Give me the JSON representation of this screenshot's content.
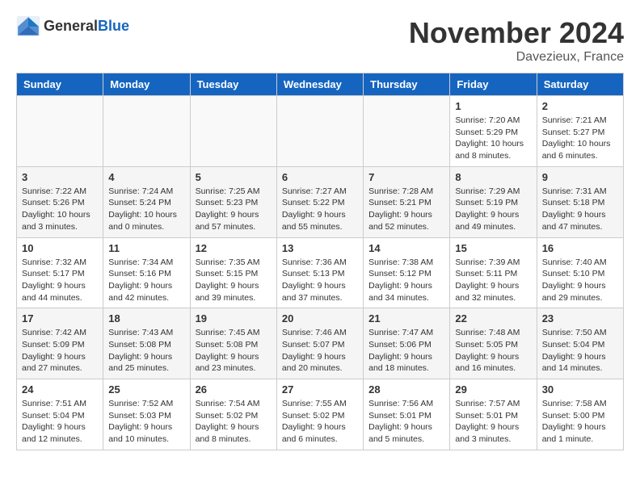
{
  "header": {
    "logo_general": "General",
    "logo_blue": "Blue",
    "month_title": "November 2024",
    "location": "Davezieux, France"
  },
  "weekdays": [
    "Sunday",
    "Monday",
    "Tuesday",
    "Wednesday",
    "Thursday",
    "Friday",
    "Saturday"
  ],
  "weeks": [
    [
      {
        "day": "",
        "info": ""
      },
      {
        "day": "",
        "info": ""
      },
      {
        "day": "",
        "info": ""
      },
      {
        "day": "",
        "info": ""
      },
      {
        "day": "",
        "info": ""
      },
      {
        "day": "1",
        "info": "Sunrise: 7:20 AM\nSunset: 5:29 PM\nDaylight: 10 hours\nand 8 minutes."
      },
      {
        "day": "2",
        "info": "Sunrise: 7:21 AM\nSunset: 5:27 PM\nDaylight: 10 hours\nand 6 minutes."
      }
    ],
    [
      {
        "day": "3",
        "info": "Sunrise: 7:22 AM\nSunset: 5:26 PM\nDaylight: 10 hours\nand 3 minutes."
      },
      {
        "day": "4",
        "info": "Sunrise: 7:24 AM\nSunset: 5:24 PM\nDaylight: 10 hours\nand 0 minutes."
      },
      {
        "day": "5",
        "info": "Sunrise: 7:25 AM\nSunset: 5:23 PM\nDaylight: 9 hours\nand 57 minutes."
      },
      {
        "day": "6",
        "info": "Sunrise: 7:27 AM\nSunset: 5:22 PM\nDaylight: 9 hours\nand 55 minutes."
      },
      {
        "day": "7",
        "info": "Sunrise: 7:28 AM\nSunset: 5:21 PM\nDaylight: 9 hours\nand 52 minutes."
      },
      {
        "day": "8",
        "info": "Sunrise: 7:29 AM\nSunset: 5:19 PM\nDaylight: 9 hours\nand 49 minutes."
      },
      {
        "day": "9",
        "info": "Sunrise: 7:31 AM\nSunset: 5:18 PM\nDaylight: 9 hours\nand 47 minutes."
      }
    ],
    [
      {
        "day": "10",
        "info": "Sunrise: 7:32 AM\nSunset: 5:17 PM\nDaylight: 9 hours\nand 44 minutes."
      },
      {
        "day": "11",
        "info": "Sunrise: 7:34 AM\nSunset: 5:16 PM\nDaylight: 9 hours\nand 42 minutes."
      },
      {
        "day": "12",
        "info": "Sunrise: 7:35 AM\nSunset: 5:15 PM\nDaylight: 9 hours\nand 39 minutes."
      },
      {
        "day": "13",
        "info": "Sunrise: 7:36 AM\nSunset: 5:13 PM\nDaylight: 9 hours\nand 37 minutes."
      },
      {
        "day": "14",
        "info": "Sunrise: 7:38 AM\nSunset: 5:12 PM\nDaylight: 9 hours\nand 34 minutes."
      },
      {
        "day": "15",
        "info": "Sunrise: 7:39 AM\nSunset: 5:11 PM\nDaylight: 9 hours\nand 32 minutes."
      },
      {
        "day": "16",
        "info": "Sunrise: 7:40 AM\nSunset: 5:10 PM\nDaylight: 9 hours\nand 29 minutes."
      }
    ],
    [
      {
        "day": "17",
        "info": "Sunrise: 7:42 AM\nSunset: 5:09 PM\nDaylight: 9 hours\nand 27 minutes."
      },
      {
        "day": "18",
        "info": "Sunrise: 7:43 AM\nSunset: 5:08 PM\nDaylight: 9 hours\nand 25 minutes."
      },
      {
        "day": "19",
        "info": "Sunrise: 7:45 AM\nSunset: 5:08 PM\nDaylight: 9 hours\nand 23 minutes."
      },
      {
        "day": "20",
        "info": "Sunrise: 7:46 AM\nSunset: 5:07 PM\nDaylight: 9 hours\nand 20 minutes."
      },
      {
        "day": "21",
        "info": "Sunrise: 7:47 AM\nSunset: 5:06 PM\nDaylight: 9 hours\nand 18 minutes."
      },
      {
        "day": "22",
        "info": "Sunrise: 7:48 AM\nSunset: 5:05 PM\nDaylight: 9 hours\nand 16 minutes."
      },
      {
        "day": "23",
        "info": "Sunrise: 7:50 AM\nSunset: 5:04 PM\nDaylight: 9 hours\nand 14 minutes."
      }
    ],
    [
      {
        "day": "24",
        "info": "Sunrise: 7:51 AM\nSunset: 5:04 PM\nDaylight: 9 hours\nand 12 minutes."
      },
      {
        "day": "25",
        "info": "Sunrise: 7:52 AM\nSunset: 5:03 PM\nDaylight: 9 hours\nand 10 minutes."
      },
      {
        "day": "26",
        "info": "Sunrise: 7:54 AM\nSunset: 5:02 PM\nDaylight: 9 hours\nand 8 minutes."
      },
      {
        "day": "27",
        "info": "Sunrise: 7:55 AM\nSunset: 5:02 PM\nDaylight: 9 hours\nand 6 minutes."
      },
      {
        "day": "28",
        "info": "Sunrise: 7:56 AM\nSunset: 5:01 PM\nDaylight: 9 hours\nand 5 minutes."
      },
      {
        "day": "29",
        "info": "Sunrise: 7:57 AM\nSunset: 5:01 PM\nDaylight: 9 hours\nand 3 minutes."
      },
      {
        "day": "30",
        "info": "Sunrise: 7:58 AM\nSunset: 5:00 PM\nDaylight: 9 hours\nand 1 minute."
      }
    ]
  ]
}
